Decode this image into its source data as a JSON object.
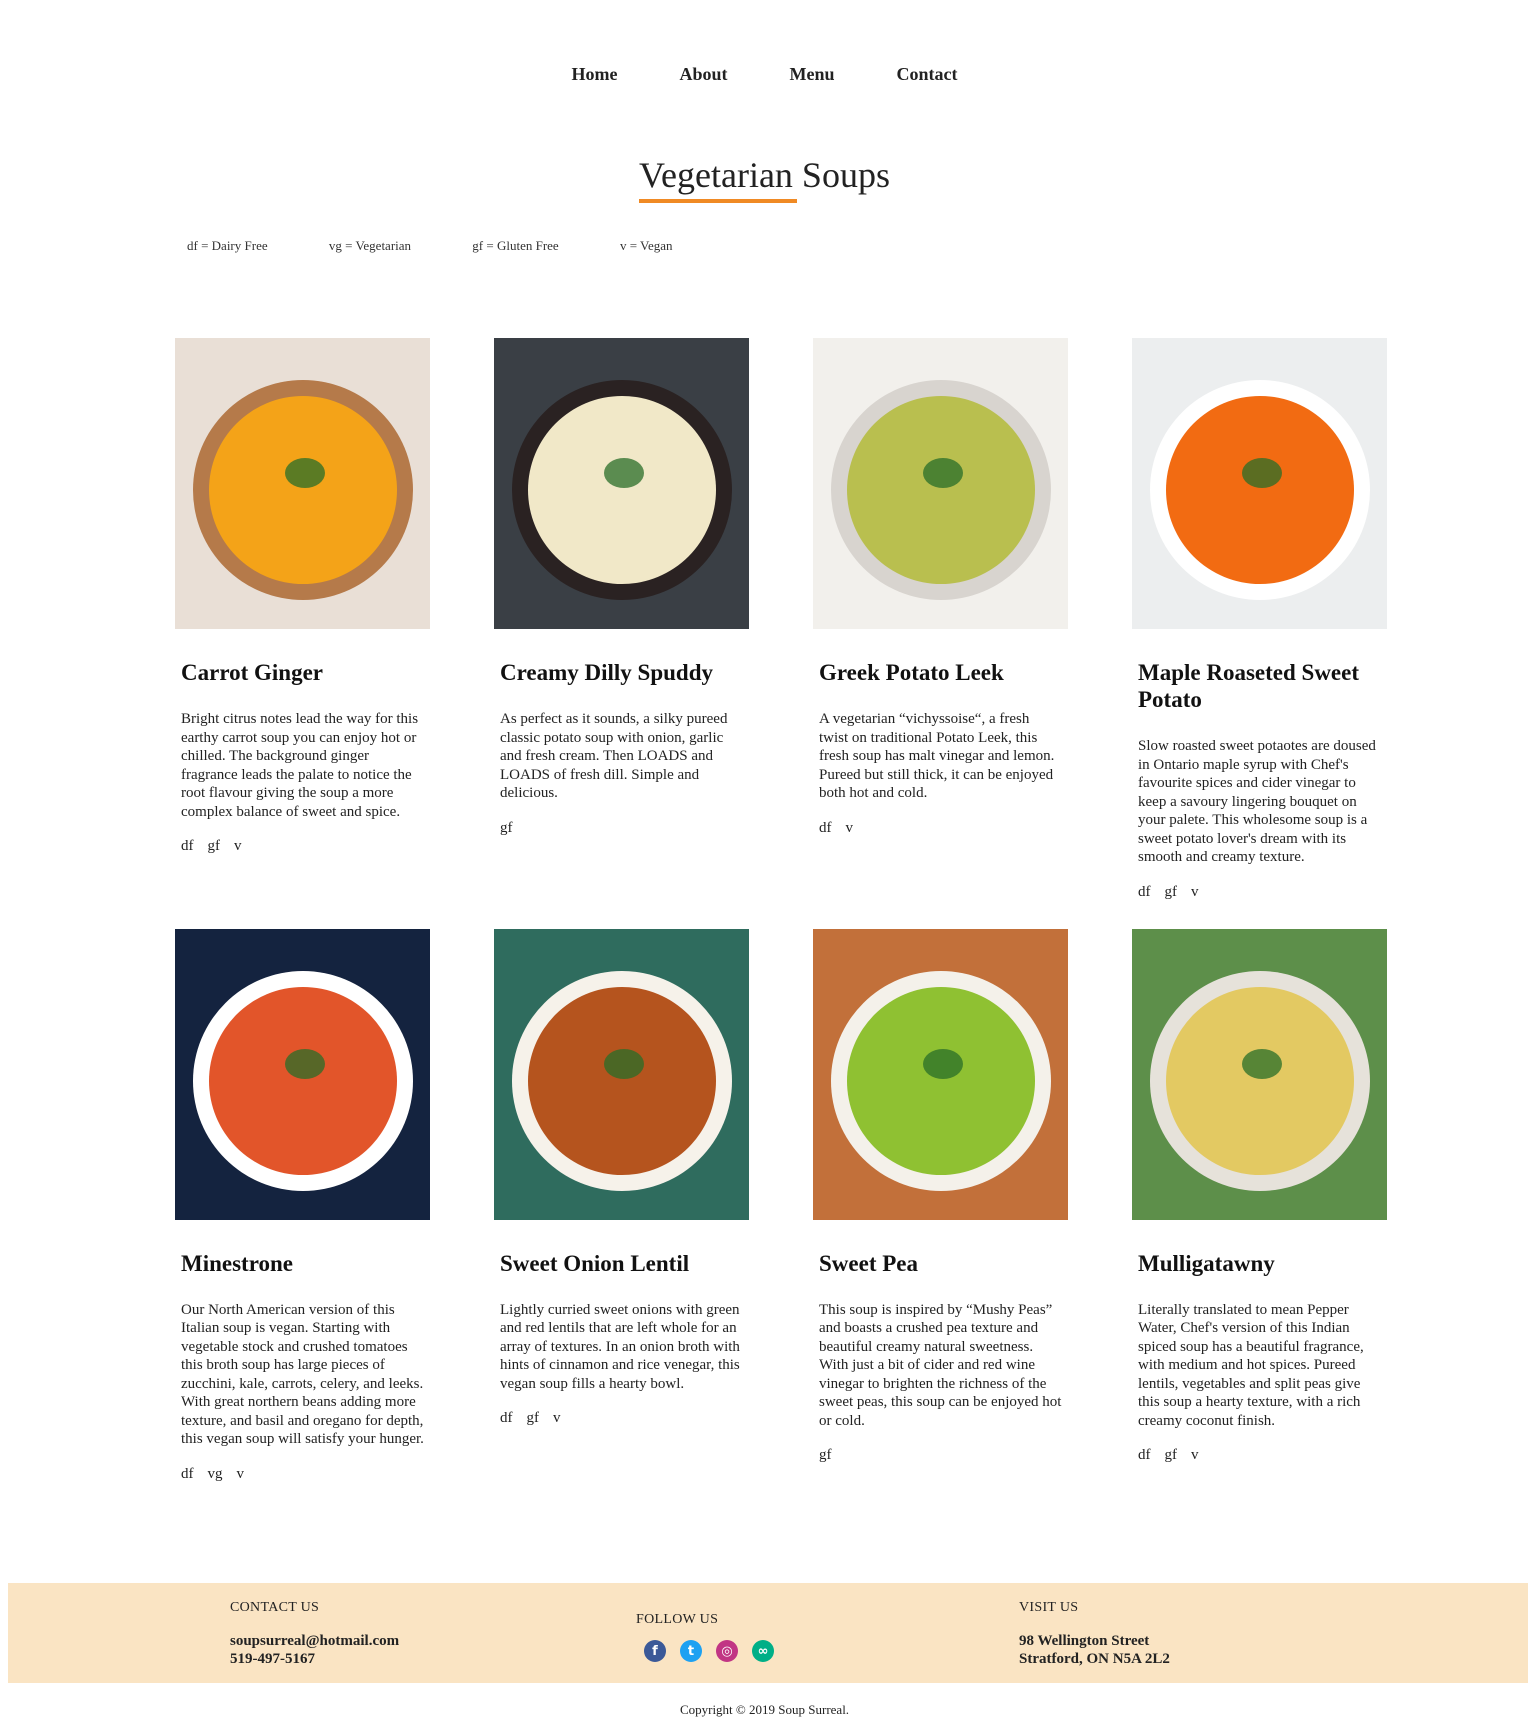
{
  "nav": [
    {
      "label": "Home"
    },
    {
      "label": "About"
    },
    {
      "label": "Menu"
    },
    {
      "label": "Contact"
    }
  ],
  "page_title": "Vegetarian Soups",
  "legend": [
    {
      "text": "df = Dairy Free"
    },
    {
      "text": "vg = Vegetarian"
    },
    {
      "text": "gf = Gluten Free"
    },
    {
      "text": "v = Vegan"
    }
  ],
  "colors": {
    "accent_underline": "#f08a24",
    "footer_bg": "#fae4c3"
  },
  "soups": [
    {
      "name": "Carrot Ginger",
      "desc": "Bright citrus notes lead the way for this earthy carrot soup you can enjoy hot or chilled. The background ginger fragrance leads the palate to notice the root flavour giving the soup a more complex balance of sweet and spice.",
      "tags": [
        "df",
        "gf",
        "v"
      ],
      "bg": "#e9dfd6",
      "rim": "#b57a4a",
      "soup": "#f4a318"
    },
    {
      "name": "Creamy Dilly Spuddy",
      "desc": "As perfect as it sounds, a silky pureed classic potato soup with onion, garlic and fresh cream. Then LOADS and LOADS of fresh dill. Simple and delicious.",
      "tags": [
        "gf"
      ],
      "bg": "#3a3f45",
      "rim": "#2a2222",
      "soup": "#f1e8c8"
    },
    {
      "name": "Greek Potato Leek",
      "desc": "A vegetarian “vichyssoise“, a fresh twist on traditional Potato Leek, this fresh soup has malt vinegar and lemon. Pureed but still thick, it can be enjoyed both hot and cold.",
      "tags": [
        "df",
        "v"
      ],
      "bg": "#f2f0ec",
      "rim": "#d8d4cf",
      "soup": "#b9bf4f"
    },
    {
      "name": "Maple Roaseted Sweet Potato",
      "desc": "Slow roasted sweet potaotes are doused in Ontario maple syrup with Chef's favourite spices and cider vinegar to keep a savoury lingering bouquet on your palete. This wholesome soup is a sweet potato lover's dream with its smooth and creamy texture.",
      "tags": [
        "df",
        "gf",
        "v"
      ],
      "bg": "#eceeef",
      "rim": "#ffffff",
      "soup": "#f26b12"
    },
    {
      "name": "Minestrone",
      "desc": "Our North American version of this Italian soup is vegan. Starting with vegetable stock and crushed tomatoes this broth soup has large pieces of zucchini, kale, carrots, celery, and leeks. With great northern beans adding more texture, and basil and oregano for depth, this vegan soup will satisfy your hunger.",
      "tags": [
        "df",
        "vg",
        "v"
      ],
      "bg": "#14233f",
      "rim": "#ffffff",
      "soup": "#e2552a"
    },
    {
      "name": "Sweet Onion Lentil",
      "desc": "Lightly curried sweet onions with green and red lentils that are left whole for an array of textures. In an onion broth with hints of cinnamon and rice venegar, this vegan soup fills a hearty bowl.",
      "tags": [
        "df",
        "gf",
        "v"
      ],
      "bg": "#2f6c5e",
      "rim": "#f6f2ea",
      "soup": "#b5541e"
    },
    {
      "name": "Sweet Pea",
      "desc": "This soup is inspired by “Mushy Peas” and boasts a crushed pea texture and beautiful creamy natural sweetness. With just a bit of cider and red wine vinegar to brighten the richness of the sweet peas, this soup can be enjoyed hot or cold.",
      "tags": [
        "gf"
      ],
      "bg": "#c2703a",
      "rim": "#f4f1ea",
      "soup": "#8fc132"
    },
    {
      "name": "Mulligatawny",
      "desc": "Literally translated to mean Pepper Water, Chef's version of this Indian spiced soup has a beautiful fragrance, with medium and hot spices. Pureed lentils, vegetables and split peas give this soup a hearty texture, with a rich creamy coconut finish.",
      "tags": [
        "df",
        "gf",
        "v"
      ],
      "bg": "#5d8f4a",
      "rim": "#e6e2da",
      "soup": "#e3c962"
    }
  ],
  "footer": {
    "contact": {
      "heading": "CONTACT US",
      "email": "soupsurreal@hotmail.com",
      "phone": "519-497-5167"
    },
    "follow": {
      "heading": "FOLLOW US",
      "icons": [
        {
          "name": "facebook-icon",
          "glyph": "f",
          "color": "#3b5998"
        },
        {
          "name": "twitter-icon",
          "glyph": "t",
          "color": "#1da1f2"
        },
        {
          "name": "instagram-icon",
          "glyph": "◎",
          "color": "#c13584"
        },
        {
          "name": "tripadvisor-icon",
          "glyph": "∞",
          "color": "#00af87"
        }
      ]
    },
    "visit": {
      "heading": "VISIT US",
      "address1": "98 Wellington Street",
      "address2": "Stratford, ON N5A 2L2"
    }
  },
  "copyright": "Copyright © 2019 Soup Surreal."
}
